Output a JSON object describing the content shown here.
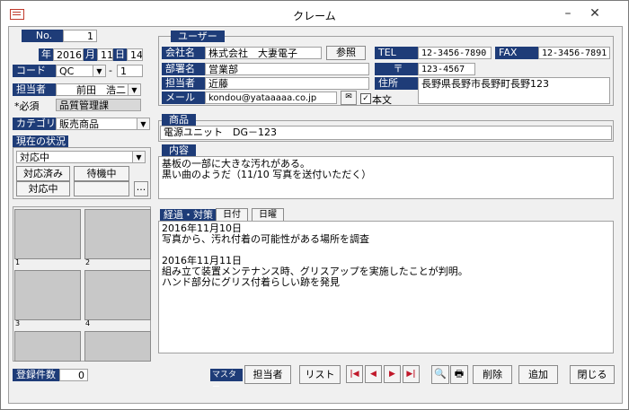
{
  "window": {
    "title": "クレーム",
    "minimize": "–",
    "close": "✕"
  },
  "record": {
    "no_label": "No.",
    "no_value": "1"
  },
  "date": {
    "year_label": "年",
    "year_value": "2016",
    "month_label": "月",
    "month_value": "11",
    "day_label": "日",
    "day_value": "14"
  },
  "code": {
    "label": "コード",
    "value": "QC",
    "sep": "-",
    "num": "1"
  },
  "owner": {
    "label": "担当者",
    "value": "前田　浩二",
    "required_label": "*必須",
    "dept": "品質管理課"
  },
  "category": {
    "label": "カテゴリ",
    "value": "販売商品"
  },
  "status": {
    "label": "現在の状況",
    "value": "対応中",
    "btn_done": "対応済み",
    "btn_wait": "待機中",
    "btn_active": "対応中",
    "btn_more": "..."
  },
  "user": {
    "section": "ユーザー",
    "company_label": "会社名",
    "company_value": "株式会社　大妻電子",
    "ref_button": "参照",
    "dept_label": "部署名",
    "dept_value": "営業部",
    "person_label": "担当者",
    "person_value": "近藤",
    "mail_label": "メール",
    "mail_value": "kondou@yataaaaa.co.jp",
    "body_label": "本文",
    "tel_label": "TEL",
    "tel_value": "12-3456-7890",
    "fax_label": "FAX",
    "fax_value": "12-3456-7891",
    "zip_label": "〒",
    "zip_value": "123-4567",
    "addr_label": "住所",
    "addr_value": "長野県長野市長野町長野123"
  },
  "product": {
    "section": "商品",
    "value": "電源ユニット　DG－123"
  },
  "content": {
    "section": "内容",
    "value": "基板の一部に大きな汚れがある。\n黒い曲のようだ（11/10 写真を送付いただく）"
  },
  "progress": {
    "section": "経過・対策",
    "tab_date": "日付",
    "tab_day": "日曜",
    "value": "2016年11月10日\n写真から、汚れ付着の可能性がある場所を調査\n\n2016年11月11日\n組み立て装置メンテナンス時、グリスアップを実施したことが判明。\nハンド部分にグリス付着らしい跡を発見"
  },
  "photos": {
    "n1": "1",
    "n2": "2",
    "n3": "3",
    "n4": "4"
  },
  "footer": {
    "count_label": "登録件数",
    "count_value": "0",
    "master_label": "マスター",
    "owner_button": "担当者",
    "list_button": "リスト",
    "nav_first": "|◀",
    "nav_prev": "◀",
    "nav_next": "▶",
    "nav_last": "▶|",
    "delete_button": "削除",
    "add_button": "追加",
    "close_button": "閉じる"
  },
  "colors": {
    "label_bg": "#1e3c78",
    "nav_red": "#c0182a",
    "client_bg": "#f0f0f0"
  }
}
